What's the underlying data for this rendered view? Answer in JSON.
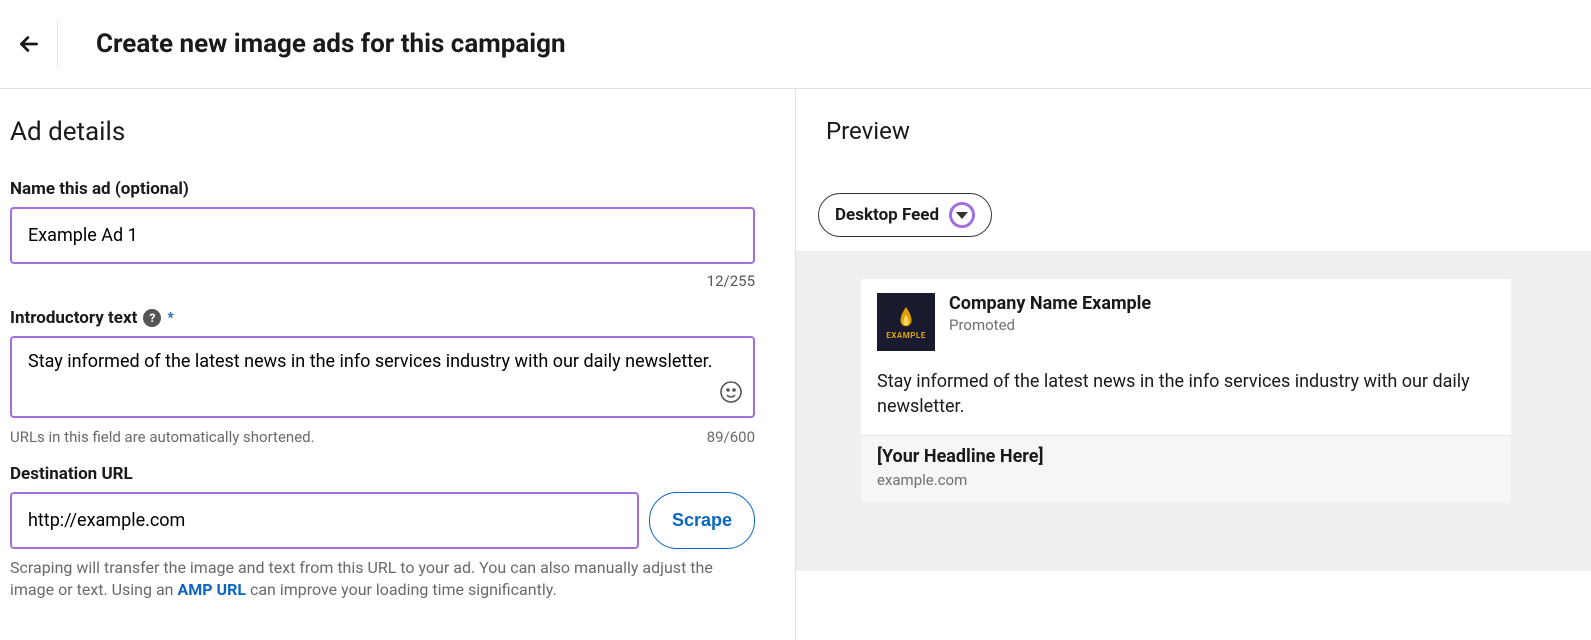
{
  "header": {
    "title": "Create new image ads for this campaign"
  },
  "left": {
    "section_title": "Ad details",
    "ad_name": {
      "label": "Name this ad (optional)",
      "value": "Example Ad 1",
      "counter": "12/255"
    },
    "intro_text": {
      "label": "Introductory text",
      "value": "Stay informed of the latest news in the info services industry with our daily newsletter.",
      "hint": "URLs in this field are automatically shortened.",
      "counter": "89/600"
    },
    "dest_url": {
      "label": "Destination URL",
      "value": "http://example.com",
      "scrape_label": "Scrape",
      "help_pre": "Scraping will transfer the image and text from this URL to your ad. You can also manually adjust the image or text. Using an ",
      "help_link": "AMP URL",
      "help_post": " can improve your loading time significantly."
    }
  },
  "right": {
    "title": "Preview",
    "view_selector": "Desktop Feed",
    "card": {
      "company": "Company Name Example",
      "promoted": "Promoted",
      "logo_text": "EXAMPLE",
      "intro": "Stay informed of the latest news in the info services industry with our daily newsletter.",
      "headline": "[Your Headline Here]",
      "domain": "example.com"
    }
  }
}
